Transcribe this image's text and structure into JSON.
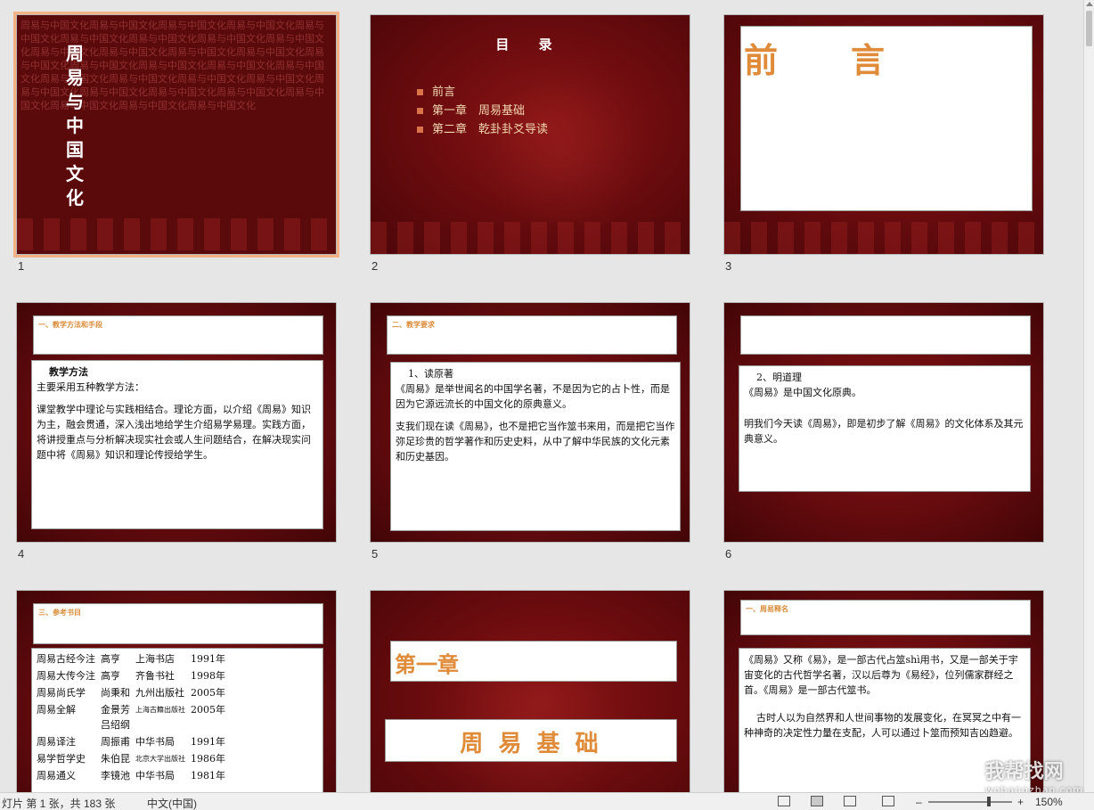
{
  "slides": [
    {
      "num": "1",
      "title_vertical": [
        "周",
        "易",
        "与",
        "中",
        "国",
        "文",
        "化"
      ],
      "texture_text": "周易与中国文化周易与中国文化周易与中国文化周易与中国文化周易与中国文化周易与中国文化周易与中国文化周易与中国文化周易与中国文化周易与中国文化周易与中国文化周易与中国文化周易与中国文化周易与中国文化周易与中国文化周易与中国文化周易与中国文化周易与中国文化周易与中国文化周易与中国文化周易与中国文化周易与中国文化周易与中国文化周易与中国文化周易与中国文化周易与中国文化周易与中国文化周易与中国文化周易与中国文化周易与中国文化"
    },
    {
      "num": "2",
      "title": "目 录",
      "items": [
        "前言",
        "第一章　周易基础",
        "第二章　乾卦卦爻导读"
      ]
    },
    {
      "num": "3",
      "title": "前　　言"
    },
    {
      "num": "4",
      "heading": "一、教学方法和手段",
      "subheading": "教学方法",
      "paragraphs": [
        "主要采用五种教学方法：",
        "课堂教学中理论与实践相结合。理论方面，以介绍《周易》知识为主，融会贯通，深入浅出地给学生介绍易学易理。实践方面，将讲授重点与分析解决现实社会或人生问题结合，在解决现实问题中将《周易》知识和理论传授给学生。"
      ]
    },
    {
      "num": "5",
      "heading": "二、教学要求",
      "subheading": "1、读原著",
      "paragraphs": [
        "《周易》是举世闻名的中国学名著，不是因为它的占卜性，而是因为它源远流长的中国文化的原典意义。",
        "支我们现在读《周易》，也不是把它当作筮书来用，而是把它当作弥足珍贵的哲学著作和历史史料，从中了解中华民族的文化元素和历史基因。"
      ]
    },
    {
      "num": "6",
      "subheading": "2、明道理",
      "paragraphs": [
        "《周易》是中国文化原典。",
        "明我们今天读《周易》，即是初步了解《周易》的文化体系及其元典意义。"
      ]
    },
    {
      "num": "7",
      "heading": "三、参考书目",
      "books": [
        [
          "周易古经今注",
          "高亨",
          "上海书店",
          "1991年"
        ],
        [
          "周易大传今注",
          "高亨",
          "齐鲁书社",
          "1998年"
        ],
        [
          "周易尚氏学",
          "尚秉和",
          "九州出版社",
          "2005年"
        ],
        [
          "周易全解",
          "金景芳\n吕绍纲",
          "上海古籍出版社",
          "2005年"
        ],
        [
          "周易译注",
          "周振甫",
          "中华书局",
          "1991年"
        ],
        [
          "易学哲学史",
          "朱伯昆",
          "北京大学出版社",
          "1986年"
        ],
        [
          "周易通义",
          "李镜池",
          "中华书局",
          "1981年"
        ]
      ]
    },
    {
      "num": "8",
      "chapter": "第一章",
      "chapter_title": "周 易 基 础"
    },
    {
      "num": "9",
      "heading": "一、周易释名",
      "paragraphs": [
        "《周易》又称《易》，是一部古代占筮shì用书，又是一部关于宇宙变化的古代哲学名著，汉以后尊为《易经》，位列儒家群经之首。《周易》是一部古代筮书。",
        "古时人以为自然界和人世间事物的发展变化，在冥冥之中有一种神奇的决定性力量在支配，人可以通过卜筮而预知吉凶趋避。"
      ]
    }
  ],
  "statusbar": {
    "slide_info": "灯片 第 1 张，共 183 张",
    "language": "中文(中国)",
    "zoom": "150%",
    "zoom_out": "–",
    "zoom_in": "+"
  },
  "watermark": {
    "text": "我帮找网",
    "url": "wobangzhao.com"
  }
}
